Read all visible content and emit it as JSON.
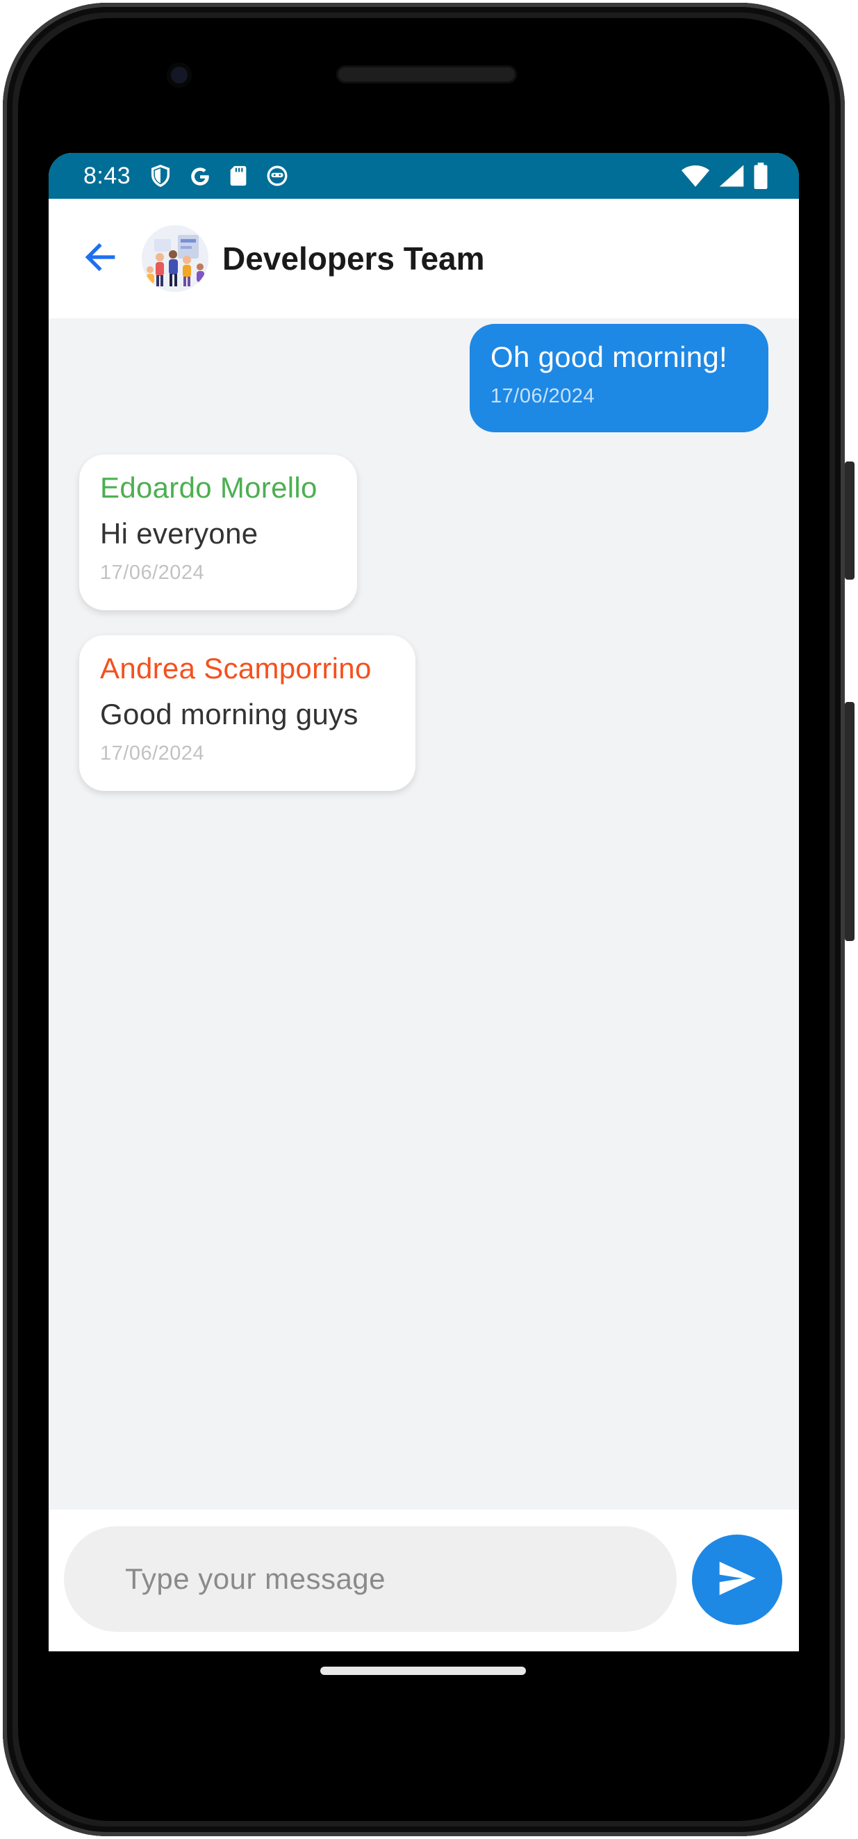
{
  "status_bar": {
    "time": "8:43",
    "left_icons": [
      "shield-icon",
      "google-g-icon",
      "sd-card-icon",
      "bug-face-icon"
    ],
    "right_icons": [
      "wifi-icon",
      "cell-signal-icon",
      "battery-icon"
    ],
    "color": "#006e96"
  },
  "app_bar": {
    "back_icon": "arrow-left-icon",
    "avatar_icon": "group-illustration-avatar",
    "title": "Developers Team"
  },
  "messages": [
    {
      "direction": "outgoing",
      "sender": "",
      "text": "Oh good morning!",
      "time": "17/06/2024"
    },
    {
      "direction": "incoming",
      "sender": "Edoardo Morello",
      "sender_color": "#4caf50",
      "text": "Hi everyone",
      "time": "17/06/2024"
    },
    {
      "direction": "incoming",
      "sender": "Andrea Scamporrino",
      "sender_color": "#f4511e",
      "text": "Good morning guys",
      "time": "17/06/2024"
    }
  ],
  "composer": {
    "placeholder": "Type your message",
    "value": "",
    "send_icon": "send-icon"
  },
  "colors": {
    "accent": "#1e88e5",
    "chat_background": "#f2f3f5",
    "incoming_bubble": "#ffffff"
  }
}
